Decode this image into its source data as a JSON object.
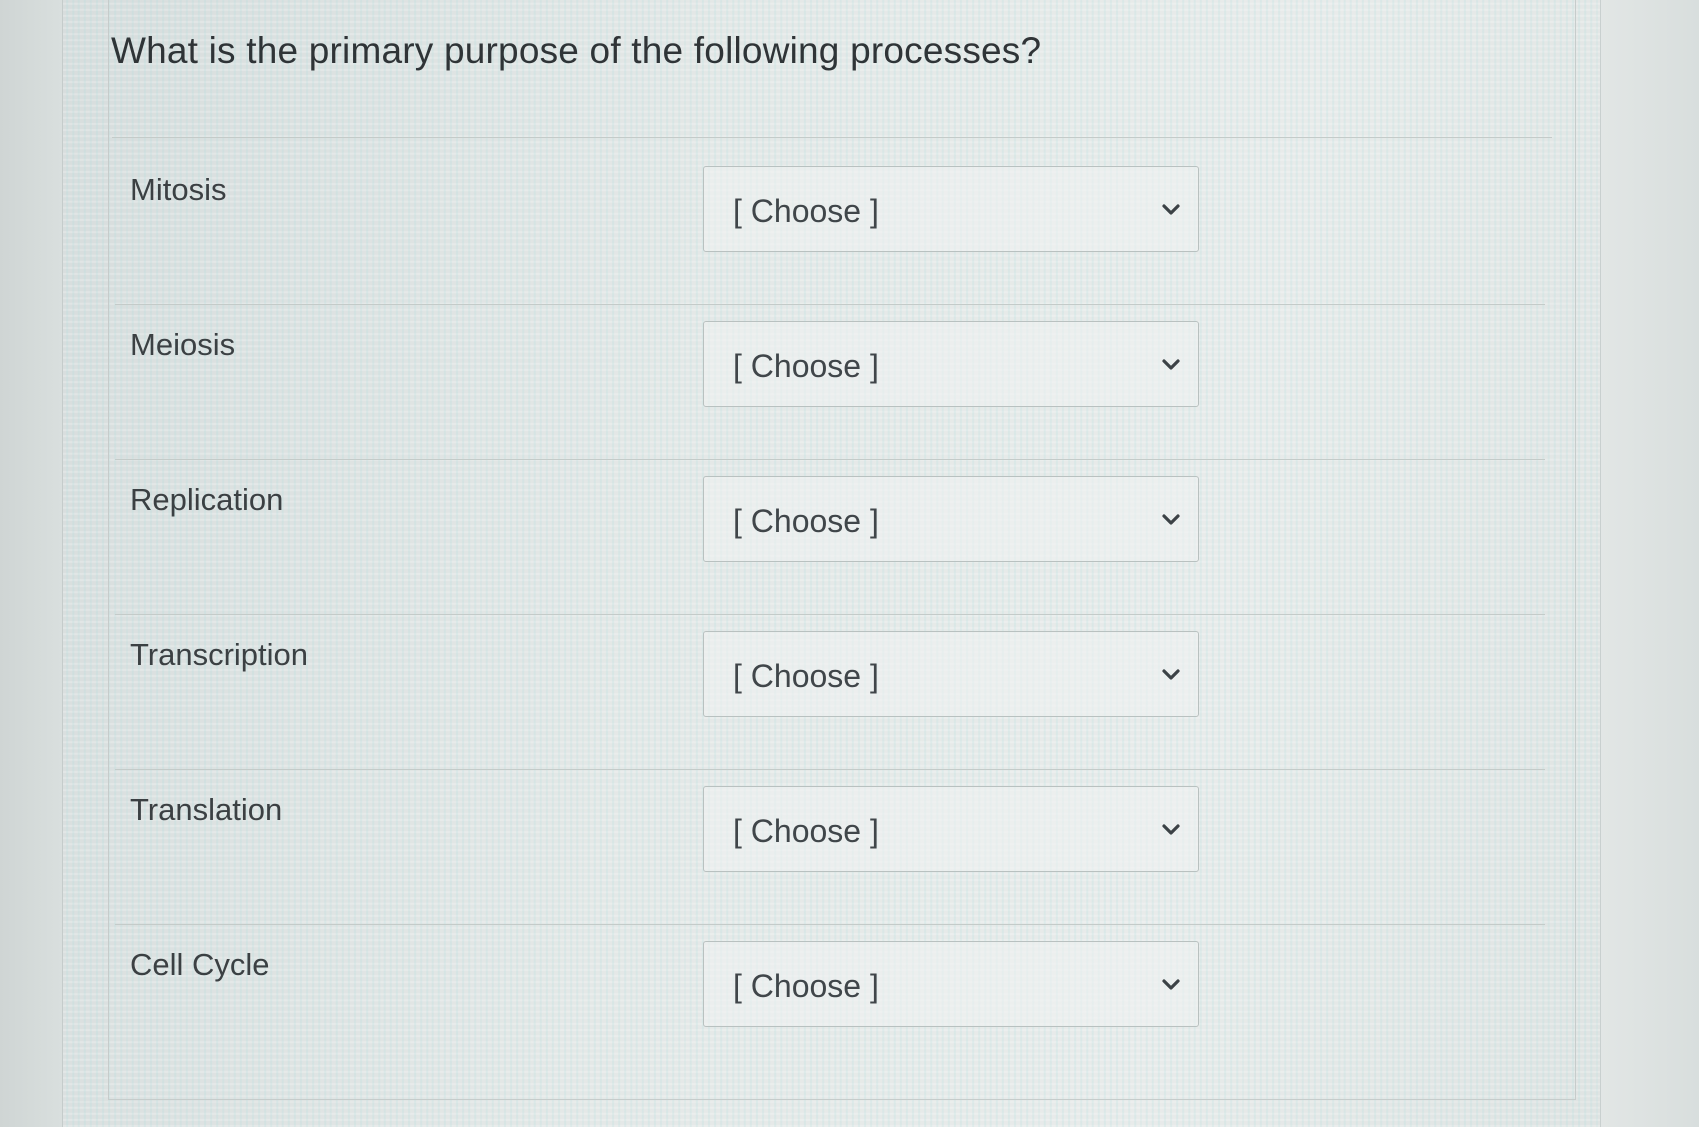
{
  "question": {
    "text": "What is the primary purpose of the following processes?"
  },
  "rows": [
    {
      "label": "Mitosis",
      "select": {
        "value": "[ Choose ]"
      }
    },
    {
      "label": "Meiosis",
      "select": {
        "value": "[ Choose ]"
      }
    },
    {
      "label": "Replication",
      "select": {
        "value": "[ Choose ]"
      }
    },
    {
      "label": "Transcription",
      "select": {
        "value": "[ Choose ]"
      }
    },
    {
      "label": "Translation",
      "select": {
        "value": "[ Choose ]"
      }
    },
    {
      "label": "Cell Cycle",
      "select": {
        "value": "[ Choose ]"
      }
    }
  ],
  "icons": {
    "dropdown": "chevron-down-icon"
  },
  "colors": {
    "text": "#2f3437",
    "border": "#c4cbc9",
    "background": "#dde2e1"
  }
}
